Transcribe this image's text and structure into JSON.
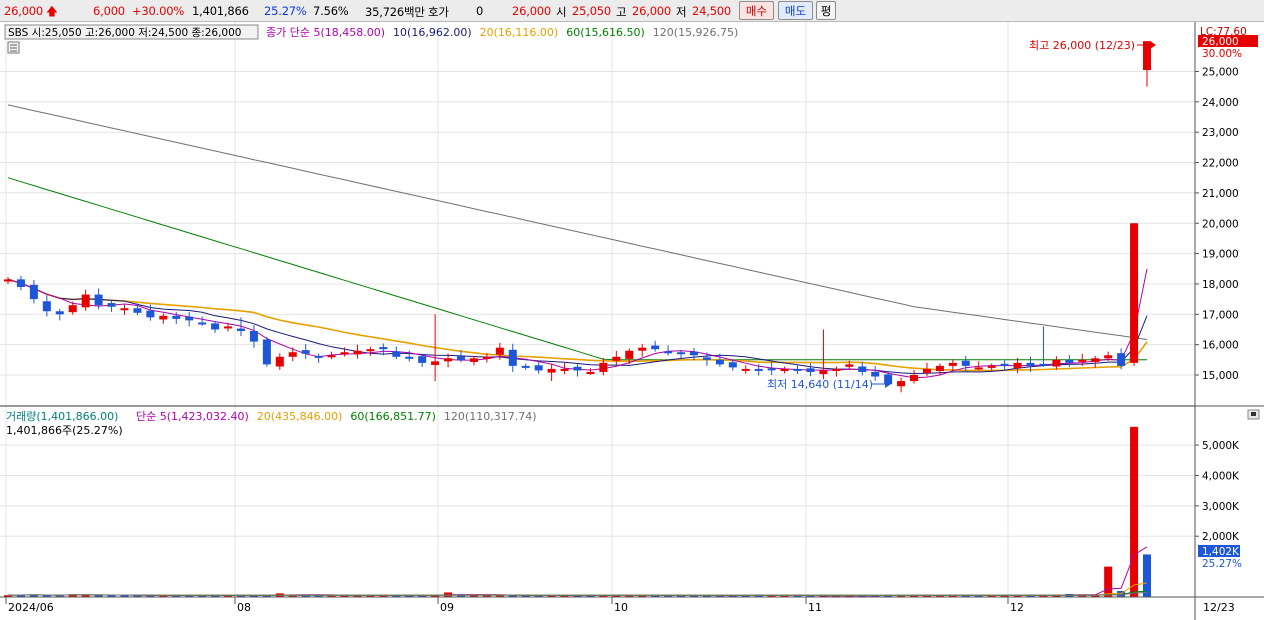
{
  "header": {
    "price": "26,000",
    "change": "6,000",
    "change_rate": "+30.00%",
    "volume": "1,401,866",
    "volume_ratio": "25.27%",
    "turnover_rate": "7.56%",
    "amount": "35,726백만",
    "hoga_label": "호가",
    "hoga_value": "0",
    "hoga_price": "26,000",
    "open_label": "시",
    "open_value": "25,050",
    "high_label": "고",
    "high_value": "26,000",
    "low_label": "저",
    "low_value": "24,500",
    "buy_button": "매수",
    "sell_button": "매도",
    "avg_button": "평"
  },
  "price_panel": {
    "info_box": "SBS 시:25,050 고:26,000 저:24,500 종:26,000",
    "ma_legend": [
      {
        "label": "종가 단순 5(18,458.00)",
        "color": "#b000b0"
      },
      {
        "label": "10(16,962.00)",
        "color": "#1a1a7a"
      },
      {
        "label": "20(16,116.00)",
        "color": "#e6a000"
      },
      {
        "label": "60(15,616.50)",
        "color": "#008000"
      },
      {
        "label": "120(15,926.75)",
        "color": "#707070"
      }
    ],
    "y_axis_labels": [
      "15,000",
      "16,000",
      "17,000",
      "18,000",
      "19,000",
      "20,000",
      "21,000",
      "22,000",
      "23,000",
      "24,000",
      "25,000"
    ],
    "current_price_badge": "26,000",
    "current_rate_badge": "30.00%",
    "lc_label": "LC:77.60",
    "high_annotation": "최고 26,000 (12/23)",
    "low_annotation": "최저 14,640 (11/14)"
  },
  "volume_panel": {
    "legend_volume": {
      "label": "거래량(1,401,866.00)",
      "color": "#008080"
    },
    "ma_legend": [
      {
        "label": "단순 5(1,423,032.40)",
        "color": "#b000b0"
      },
      {
        "label": "20(435,846.00)",
        "color": "#e6a000"
      },
      {
        "label": "60(166,851.77)",
        "color": "#008000"
      },
      {
        "label": "120(110,317.74)",
        "color": "#707070"
      }
    ],
    "info_line": "1,401,866주(25.27%)",
    "y_axis_labels": [
      "2,000K",
      "3,000K",
      "4,000K",
      "5,000K"
    ],
    "current_volume_badge": "1,402K",
    "current_volume_rate": "25.27%"
  },
  "x_axis": {
    "labels": [
      "2024/06",
      "08",
      "09",
      "10",
      "11",
      "12"
    ],
    "end_label": "12/23"
  },
  "colors": {
    "up": "#e60000",
    "down": "#1e56d8",
    "badge_bg": "#e60000",
    "volume_badge_bg": "#1e56d8"
  },
  "chart_data": {
    "type": "candlestick",
    "x": [
      "2024/06",
      "08",
      "09",
      "10",
      "11",
      "12",
      "12/23"
    ],
    "price_ylim": [
      14500,
      26200
    ],
    "volume_ylim_K": [
      0,
      5700
    ],
    "close_approx": [
      18150,
      17900,
      17500,
      17100,
      17000,
      17300,
      17650,
      17300,
      17250,
      17200,
      17050,
      16900,
      16950,
      16850,
      16800,
      16700,
      16500,
      16600,
      16450,
      16100,
      15350,
      15600,
      15750,
      15700,
      15600,
      15650,
      15750,
      15800,
      15850,
      15850,
      15600,
      15550,
      15400,
      15450,
      15550,
      15500,
      15550,
      15600,
      15900,
      15300,
      15250,
      15150,
      15200,
      15200,
      15150,
      15100,
      15400,
      15600,
      15800,
      15900,
      15850,
      15750,
      15700,
      15650,
      15500,
      15350,
      15250,
      15200,
      15150,
      15200,
      15200,
      15150,
      15100,
      15150,
      15200,
      15350,
      15100,
      14950,
      14700,
      14800,
      15000,
      15200,
      15300,
      15400,
      15300,
      15250,
      15300,
      15300,
      15400,
      15300,
      15350,
      15500,
      15400,
      15500,
      15550,
      15650,
      15300,
      20000,
      26000
    ],
    "volume_K_approx": [
      60,
      70,
      80,
      50,
      60,
      90,
      70,
      60,
      50,
      60,
      50,
      50,
      40,
      50,
      60,
      50,
      60,
      50,
      40,
      50,
      60,
      120,
      70,
      60,
      50,
      50,
      60,
      50,
      50,
      50,
      60,
      50,
      60,
      60,
      150,
      70,
      60,
      50,
      50,
      60,
      50,
      50,
      40,
      40,
      50,
      60,
      50,
      60,
      70,
      60,
      60,
      50,
      50,
      50,
      40,
      40,
      50,
      60,
      80,
      50,
      40,
      50,
      40,
      40,
      40,
      50,
      40,
      50,
      70,
      60,
      60,
      50,
      50,
      60,
      70,
      60,
      60,
      50,
      50,
      60,
      60,
      80,
      100,
      70,
      60,
      1000,
      200,
      5600,
      1402
    ],
    "moving_averages": {
      "5": 18458.0,
      "10": 16962.0,
      "20": 16116.0,
      "60": 15616.5,
      "120": 15926.75
    },
    "high": {
      "value": 26000,
      "date": "12/23"
    },
    "low": {
      "value": 14640,
      "date": "11/14"
    }
  }
}
